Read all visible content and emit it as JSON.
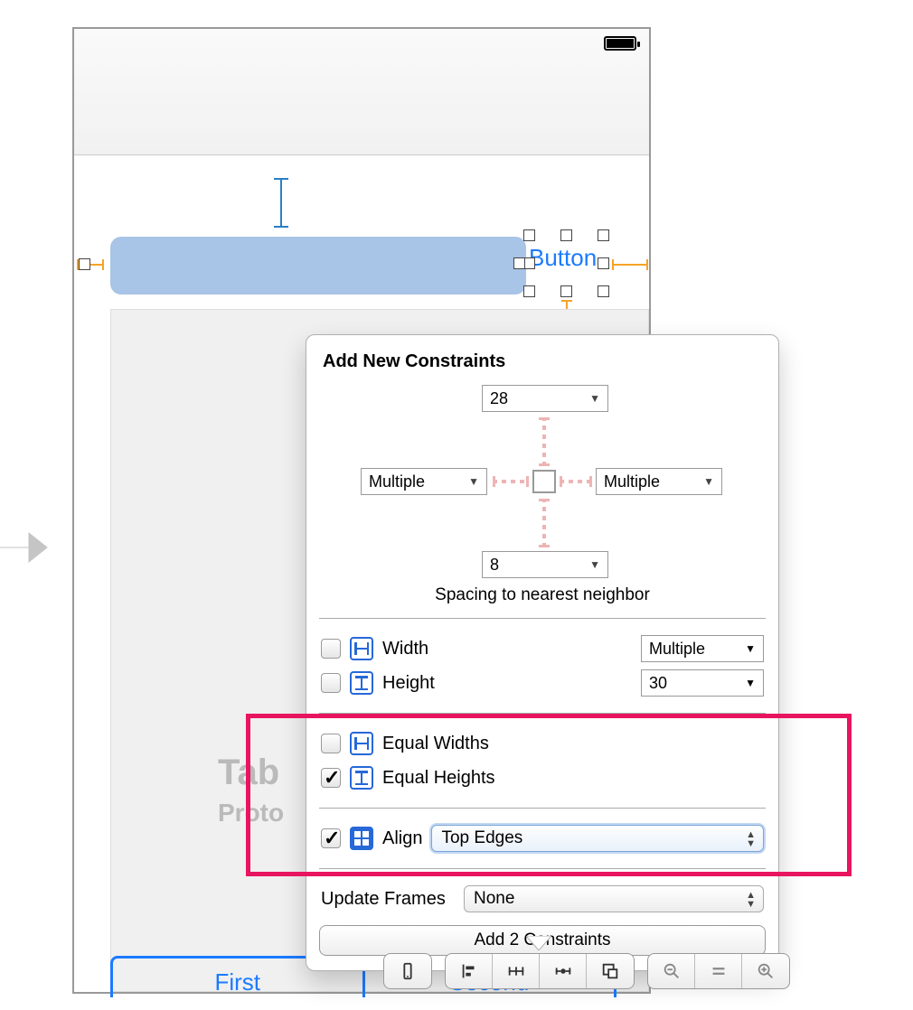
{
  "status": {
    "battery_icon": "battery-full"
  },
  "canvas": {
    "button_label": "Button",
    "table_placeholder_title": "Tab",
    "table_placeholder_subtitle": "Proto",
    "segmented": {
      "first": "First",
      "second": "Second"
    }
  },
  "popover": {
    "title": "Add New Constraints",
    "spacing": {
      "top": "28",
      "left": "Multiple",
      "right": "Multiple",
      "bottom": "8",
      "caption": "Spacing to nearest neighbor"
    },
    "size": {
      "width_label": "Width",
      "width_value": "Multiple",
      "height_label": "Height",
      "height_value": "30"
    },
    "equal": {
      "widths_label": "Equal Widths",
      "widths_checked": false,
      "heights_label": "Equal Heights",
      "heights_checked": true
    },
    "align": {
      "checked": true,
      "label": "Align",
      "value": "Top Edges"
    },
    "update_frames": {
      "label": "Update Frames",
      "value": "None"
    },
    "submit": "Add 2 Constraints"
  },
  "toolbar": {
    "device": "device-icon",
    "align": "align-icon",
    "pin": "pin-icon",
    "resolve": "resolve-icon",
    "resize": "resize-icon",
    "zoom_out": "zoom-out-icon",
    "zoom_actual": "zoom-actual-icon",
    "zoom_in": "zoom-in-icon"
  }
}
